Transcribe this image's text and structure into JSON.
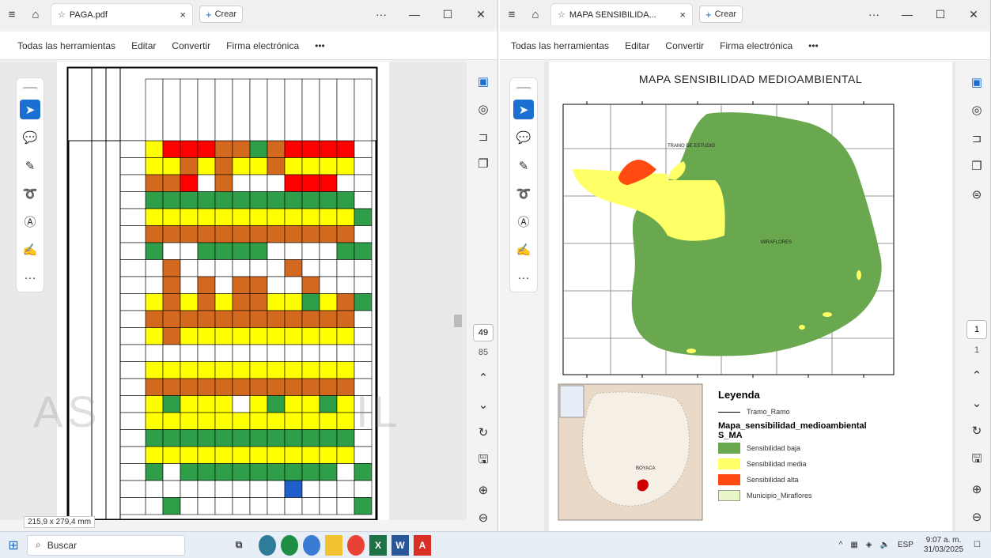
{
  "left_window": {
    "tab_label": "PAGA.pdf",
    "crear_label": "Crear",
    "menu": [
      "Todas las herramientas",
      "Editar",
      "Convertir",
      "Firma electrónica",
      "•••"
    ],
    "doc_size": "215,9 x 279,4 mm",
    "page_current": "49",
    "page_total": "85",
    "watermark_left": "AS",
    "watermark_right": "IL"
  },
  "right_window": {
    "tab_label": "MAPA SENSIBILIDA...",
    "crear_label": "Crear",
    "menu": [
      "Todas las herramientas",
      "Editar",
      "Convertir",
      "Firma electrónica",
      "•••"
    ],
    "page_current": "1",
    "page_total": "1",
    "map": {
      "title": "MAPA SENSIBILIDAD MEDIOAMBIENTAL",
      "label_tramo": "TRAMO DE ESTUDIO",
      "label_area": "MIRAFLORES",
      "inset_label": "BOYACA",
      "legend": {
        "title": "Leyenda",
        "line_label": "Tramo_Ramo",
        "group_title": "Mapa_sensibilidad_medioambiental",
        "group_sub": "S_MA",
        "items": [
          {
            "label": "Sensibilidad baja",
            "color": "#6aa84f"
          },
          {
            "label": "Sensibilidad media",
            "color": "#ffff66"
          },
          {
            "label": "Sensibilidad alta",
            "color": "#ff4b12"
          },
          {
            "label": "Municipio_Miraflores",
            "color": "#e8f6c8"
          }
        ]
      }
    }
  },
  "taskbar": {
    "search_placeholder": "Buscar",
    "lang": "ESP",
    "time": "9:07 a. m.",
    "date": "31/03/2025"
  }
}
